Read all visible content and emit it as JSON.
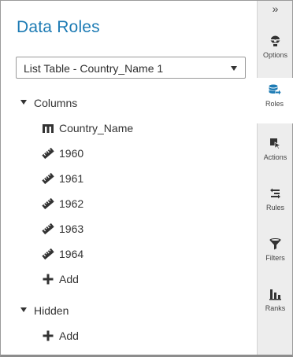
{
  "panel": {
    "title": "Data Roles",
    "object_select": {
      "value": "List Table - Country_Name 1"
    }
  },
  "columns_group": {
    "label": "Columns",
    "items": [
      {
        "label": "Country_Name",
        "icon": "category-icon"
      },
      {
        "label": "1960",
        "icon": "measure-icon"
      },
      {
        "label": "1961",
        "icon": "measure-icon"
      },
      {
        "label": "1962",
        "icon": "measure-icon"
      },
      {
        "label": "1963",
        "icon": "measure-icon"
      },
      {
        "label": "1964",
        "icon": "measure-icon"
      }
    ],
    "add_label": "Add"
  },
  "hidden_group": {
    "label": "Hidden",
    "add_label": "Add"
  },
  "rail": {
    "collapse_glyph": "»",
    "tabs": [
      {
        "label": "Options",
        "icon": "options-icon",
        "active": false
      },
      {
        "label": "Roles",
        "icon": "roles-icon",
        "active": true
      },
      {
        "label": "Actions",
        "icon": "actions-icon",
        "active": false
      },
      {
        "label": "Rules",
        "icon": "rules-icon",
        "active": false
      },
      {
        "label": "Filters",
        "icon": "filter-icon",
        "active": false
      },
      {
        "label": "Ranks",
        "icon": "ranks-icon",
        "active": false
      }
    ]
  },
  "colors": {
    "title": "#1d7bb4",
    "active_icon": "#1d7bb4",
    "icon": "#333333",
    "rail_bg": "#ededed"
  }
}
